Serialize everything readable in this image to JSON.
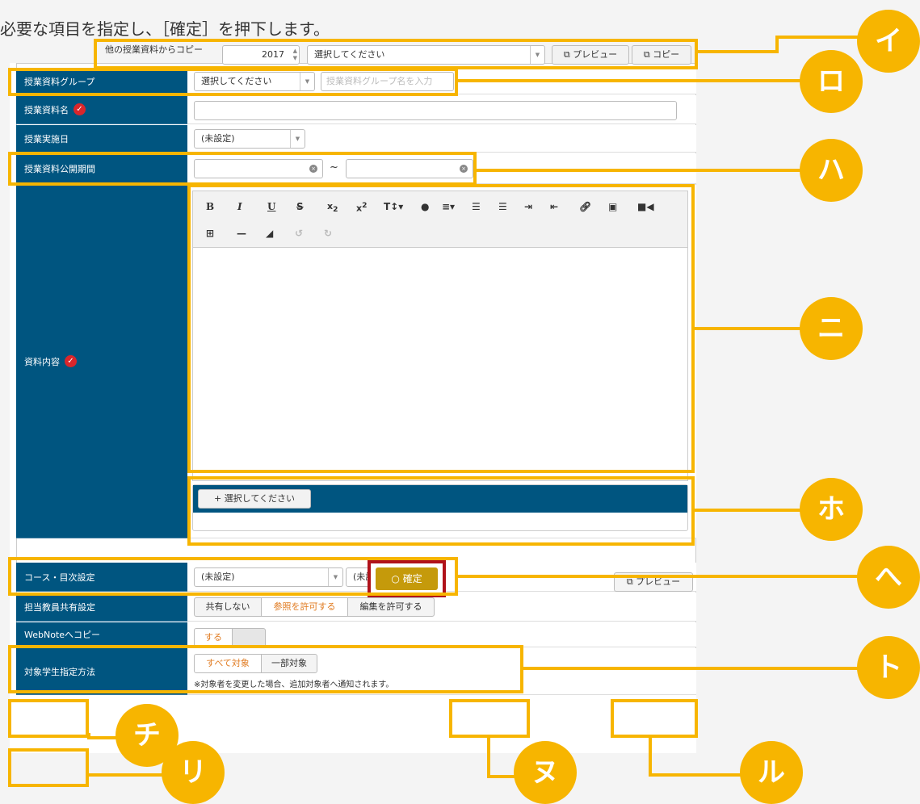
{
  "instruction": "必要な項目を指定し、［確定］を押下します。",
  "copy_bar": {
    "label": "他の授業資料からコピー",
    "year": "2017",
    "select": "選択してください",
    "preview_btn": "プレビュー",
    "copy_btn": "コピー"
  },
  "fields": {
    "group": {
      "label": "授業資料グループ",
      "select": "選択してください",
      "placeholder": "授業資料グループ名を入力"
    },
    "name": {
      "label": "授業資料名"
    },
    "date": {
      "label": "授業実施日",
      "value": "(未設定)"
    },
    "period": {
      "label": "授業資料公開期間",
      "tilde": "~"
    },
    "content": {
      "label": "資料内容"
    },
    "attach_btn": "選択してください",
    "course": {
      "label": "コース・目次設定",
      "value1": "(未設定)",
      "value2": "(未設定)"
    },
    "share": {
      "label": "担当教員共有設定",
      "options": [
        "共有しない",
        "参照を許可する",
        "編集を許可する"
      ],
      "selected": "参照を許可する"
    },
    "webnote": {
      "label": "WebNoteへコピー",
      "on": "する"
    },
    "target": {
      "label": "対象学生指定方法",
      "options": [
        "すべて対象",
        "一部対象"
      ],
      "selected": "すべて対象",
      "note": "※対象者を変更した場合、追加対象者へ通知されます。"
    }
  },
  "toolbar_icons": [
    "bold-icon",
    "italic-icon",
    "underline-icon",
    "strikethrough-icon",
    "subscript-icon",
    "superscript-icon",
    "font-size-icon",
    "color-icon",
    "align-icon",
    "ordered-list-icon",
    "unordered-list-icon",
    "indent-icon",
    "outdent-icon",
    "link-icon",
    "image-icon",
    "video-icon",
    "table-icon",
    "hr-icon",
    "eraser-icon",
    "undo-icon",
    "redo-icon"
  ],
  "confirm_btn": "確定",
  "preview_btn": "プレビュー",
  "callouts": [
    "イ",
    "ロ",
    "ハ",
    "ニ",
    "ホ",
    "へ",
    "ト",
    "チ",
    "リ",
    "ヌ",
    "ル"
  ],
  "colors": {
    "label_bg": "#005580",
    "highlight": "#f7b500",
    "confirm": "#c59a0b",
    "confirm_border": "#b0121a",
    "active_orange": "#e07a1f"
  }
}
